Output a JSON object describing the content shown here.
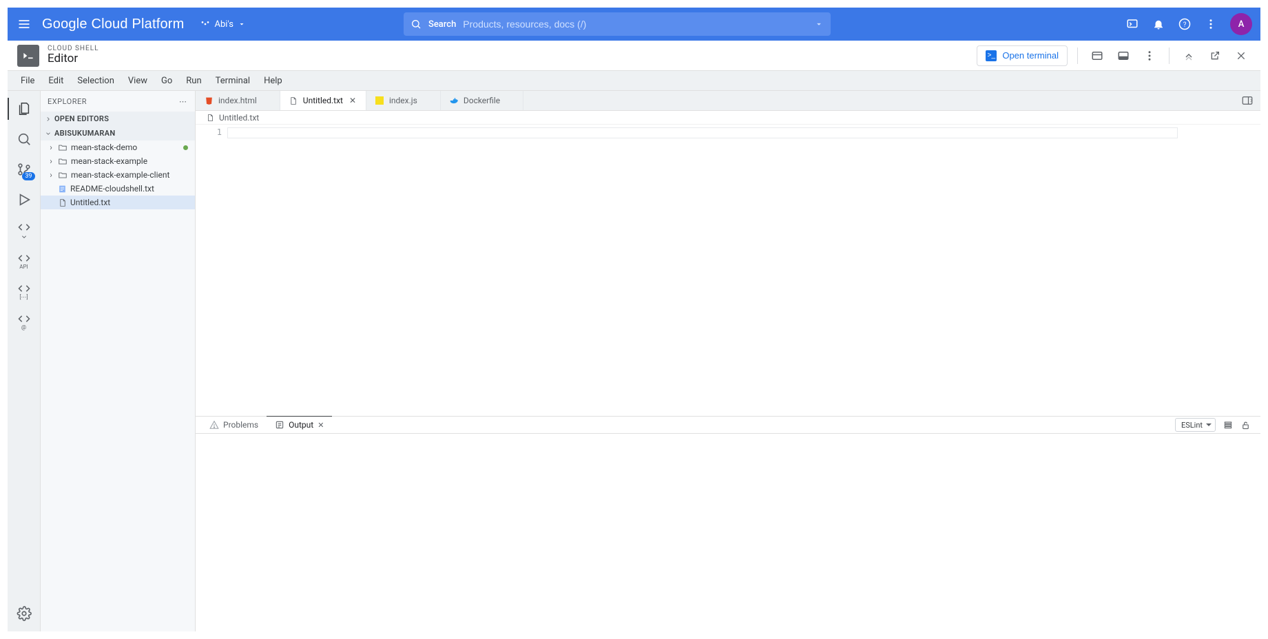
{
  "gcp": {
    "logo": "Google Cloud Platform",
    "project": "Abi's",
    "search_label": "Search",
    "search_placeholder": "Products, resources, docs (/)",
    "avatar_initial": "A"
  },
  "subheader": {
    "kicker": "CLOUD SHELL",
    "title": "Editor",
    "open_terminal": "Open terminal"
  },
  "menubar": [
    "File",
    "Edit",
    "Selection",
    "View",
    "Go",
    "Run",
    "Terminal",
    "Help"
  ],
  "activity": {
    "scm_badge": "39",
    "api_label": "API"
  },
  "explorer": {
    "title": "EXPLORER",
    "open_editors": "OPEN EDITORS",
    "workspace": "ABISUKUMARAN",
    "tree": [
      {
        "name": "mean-stack-demo",
        "type": "folder",
        "modified": true
      },
      {
        "name": "mean-stack-example",
        "type": "folder"
      },
      {
        "name": "mean-stack-example-client",
        "type": "folder"
      },
      {
        "name": "README-cloudshell.txt",
        "type": "file",
        "icon": "txt-special"
      },
      {
        "name": "Untitled.txt",
        "type": "file",
        "icon": "txt",
        "selected": true
      }
    ]
  },
  "tabs": [
    {
      "label": "index.html",
      "icon": "html"
    },
    {
      "label": "Untitled.txt",
      "icon": "txt",
      "active": true
    },
    {
      "label": "index.js",
      "icon": "js"
    },
    {
      "label": "Dockerfile",
      "icon": "docker"
    }
  ],
  "breadcrumb": "Untitled.txt",
  "editor": {
    "line_number": "1"
  },
  "panel": {
    "tabs": [
      {
        "label": "Problems",
        "icon": "warn"
      },
      {
        "label": "Output",
        "icon": "output",
        "active": true
      }
    ],
    "output_source": "ESLint"
  }
}
